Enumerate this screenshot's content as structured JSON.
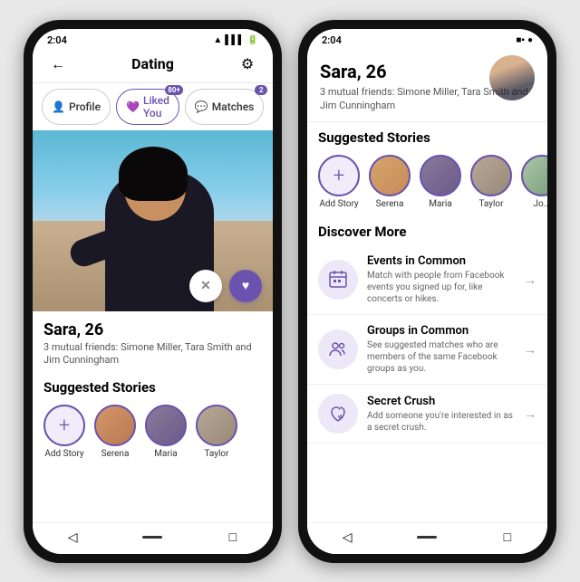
{
  "phone1": {
    "status_time": "2:04",
    "nav_title": "Dating",
    "tabs": [
      {
        "id": "profile",
        "label": "Profile",
        "icon": "👤",
        "active": false,
        "badge": null
      },
      {
        "id": "liked_you",
        "label": "Liked You",
        "icon": "💜",
        "active": false,
        "badge": "80+"
      },
      {
        "id": "matches",
        "label": "Matches",
        "icon": "💬",
        "active": false,
        "badge": "2"
      }
    ],
    "profile_name": "Sara, 26",
    "profile_friends": "3 mutual friends: Simone Miller, Tara Smith and Jim Cunningham",
    "suggested_stories_title": "Suggested Stories",
    "stories": [
      {
        "label": "Add Story",
        "type": "add"
      },
      {
        "label": "Serena",
        "type": "user1"
      },
      {
        "label": "Maria",
        "type": "user2"
      },
      {
        "label": "Taylor",
        "type": "user3"
      }
    ],
    "dislike_btn": "✕",
    "like_btn": "♥",
    "bottom_nav": [
      "◁",
      "—",
      "□"
    ]
  },
  "phone2": {
    "status_time": "2:04",
    "profile_name": "Sara, 26",
    "profile_friends": "3 mutual friends: Simone Miller, Tara Smith and Jim Cunningham",
    "suggested_stories_title": "Suggested Stories",
    "stories": [
      {
        "label": "Add Story",
        "type": "add"
      },
      {
        "label": "Serena",
        "type": "user1"
      },
      {
        "label": "Maria",
        "type": "user2"
      },
      {
        "label": "Taylor",
        "type": "user3"
      },
      {
        "label": "Jo...",
        "type": "user4"
      }
    ],
    "discover_title": "Discover More",
    "discover_items": [
      {
        "icon": "📅",
        "title": "Events in Common",
        "desc": "Match with people from Facebook events you signed up for, like concerts or hikes."
      },
      {
        "icon": "👥",
        "title": "Groups in Common",
        "desc": "See suggested matches who are members of the same Facebook groups as you."
      },
      {
        "icon": "💜",
        "title": "Secret Crush",
        "desc": "Add someone you're interested in as a secret crush."
      }
    ],
    "bottom_nav": [
      "◁",
      "—",
      "□"
    ]
  },
  "icons": {
    "back": "←",
    "gear": "⚙",
    "arrow_right": "→",
    "plus": "+"
  }
}
